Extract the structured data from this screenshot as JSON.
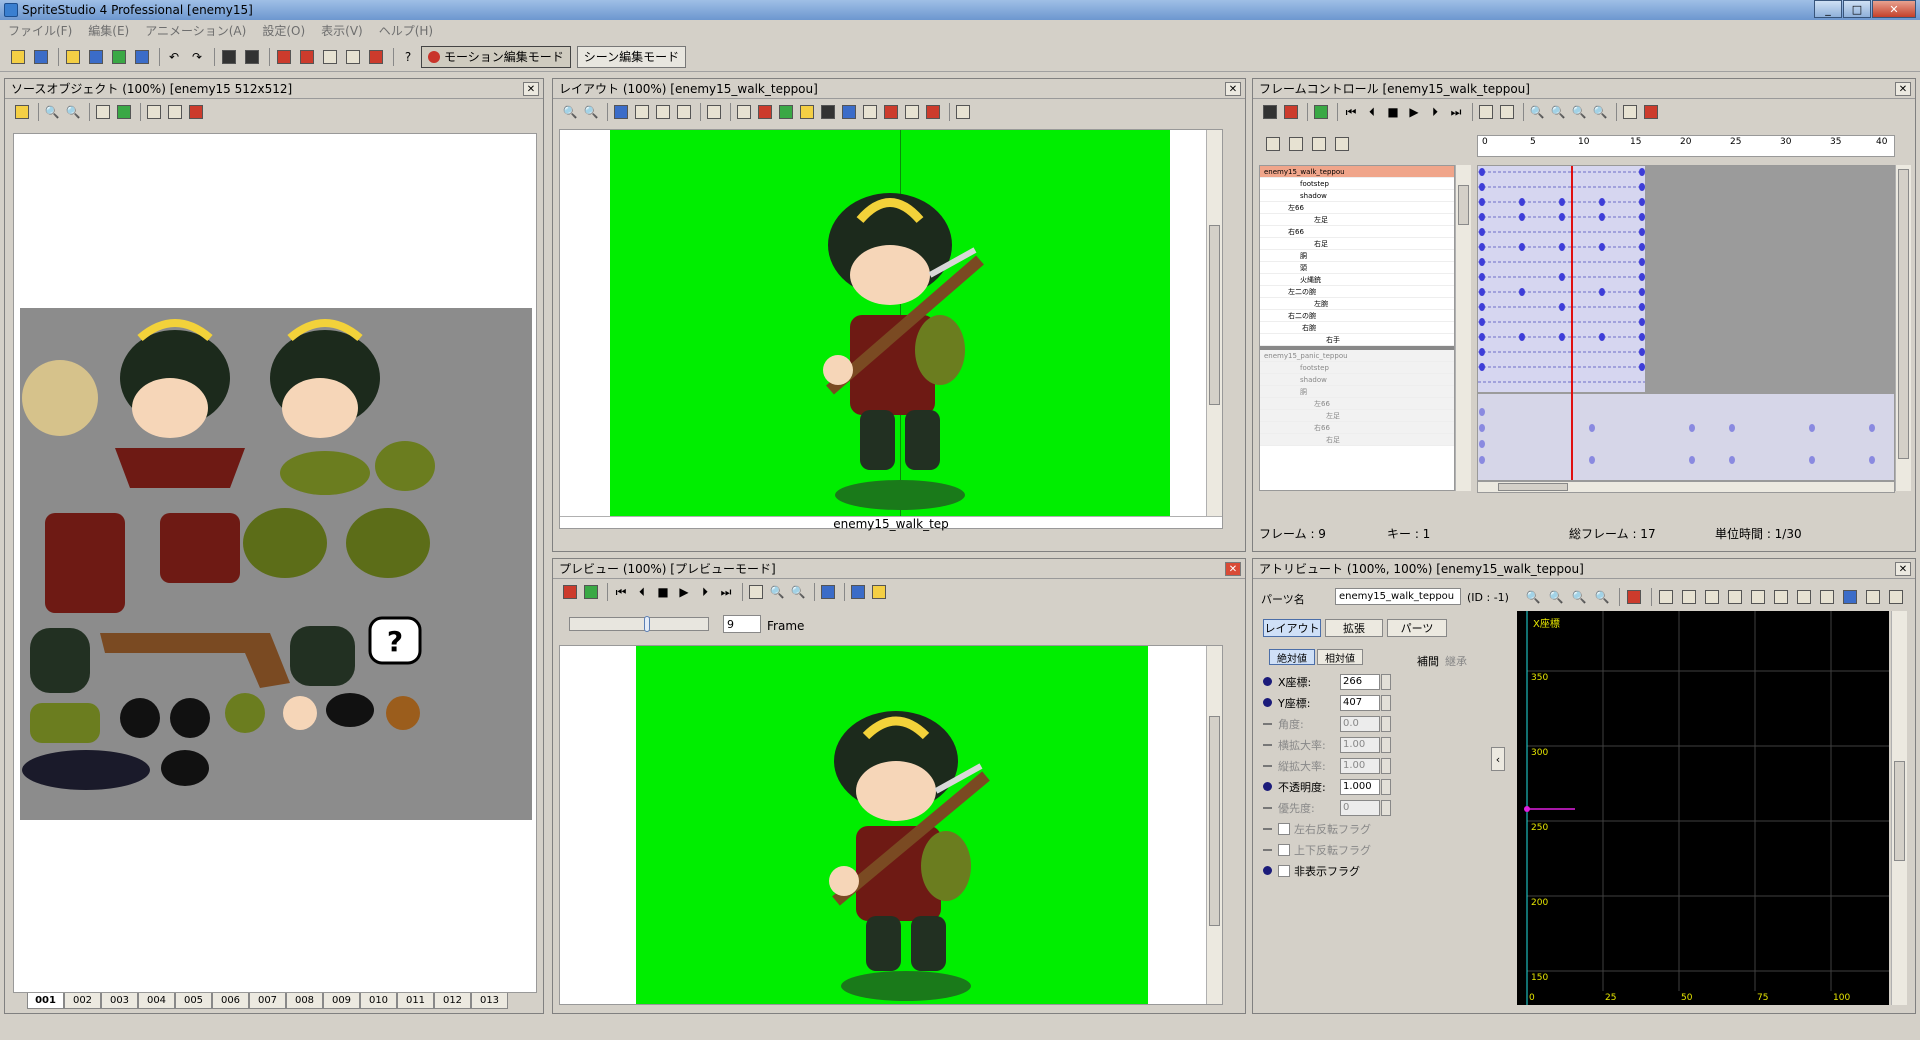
{
  "app": {
    "title": "SpriteStudio 4 Professional [enemy15]"
  },
  "menu": [
    "ファイル(F)",
    "編集(E)",
    "アニメーション(A)",
    "設定(O)",
    "表示(V)",
    "ヘルプ(H)"
  ],
  "toolbar": {
    "motion_mode": "モーション編集モード",
    "scene_mode": "シーン編集モード"
  },
  "source": {
    "title": "ソースオブジェクト (100%) [enemy15  512x512]",
    "tabs": [
      "001",
      "002",
      "003",
      "004",
      "005",
      "006",
      "007",
      "008",
      "009",
      "010",
      "011",
      "012",
      "013"
    ]
  },
  "layout": {
    "title": "レイアウト (100%) [enemy15_walk_teppou]",
    "status": "enemy15_walk_tep"
  },
  "preview": {
    "title": "プレビュー (100%) [プレビューモード]",
    "frame_value": "9",
    "frame_label": "Frame"
  },
  "frame": {
    "title": "フレームコントロール [enemy15_walk_teppou]",
    "ruler": [
      "0",
      "5",
      "10",
      "15",
      "20",
      "25",
      "30",
      "35",
      "40"
    ],
    "tree1": [
      "enemy15_walk_teppou",
      "footstep",
      "shadow",
      "左66",
      "左足",
      "右66",
      "右足",
      "胴",
      "頭",
      "火縄銃",
      "左二の腕",
      "左腕",
      "右二の腕",
      "右腕",
      "右手"
    ],
    "tree2": [
      "enemy15_panic_teppou",
      "footstep",
      "shadow",
      "胴",
      "左66",
      "左足",
      "右66",
      "右足"
    ],
    "status": {
      "frame": "フレーム : 9",
      "key": "キー : 1",
      "total": "総フレーム : 17",
      "unit": "単位時間 : 1/30"
    }
  },
  "attr": {
    "title": "アトリビュート (100%, 100%) [enemy15_walk_teppou]",
    "part_label": "パーツ名",
    "part_name": "enemy15_walk_teppou",
    "part_id": "(ID : -1)",
    "tabs": [
      "レイアウト",
      "拡張",
      "パーツ"
    ],
    "mode_abs": "絶対値",
    "mode_rel": "相対値",
    "interp": "補間",
    "inherit": "継承",
    "rows": [
      {
        "label": "X座標:",
        "value": "266"
      },
      {
        "label": "Y座標:",
        "value": "407"
      },
      {
        "label": "角度:",
        "value": "0.0"
      },
      {
        "label": "横拡大率:",
        "value": "1.00"
      },
      {
        "label": "縦拡大率:",
        "value": "1.00"
      },
      {
        "label": "不透明度:",
        "value": "1.000"
      },
      {
        "label": "優先度:",
        "value": "0"
      }
    ],
    "flags": [
      "左右反転フラグ",
      "上下反転フラグ",
      "非表示フラグ"
    ],
    "graph": {
      "title": "X座標",
      "ylabels": [
        "350",
        "300",
        "250",
        "200",
        "150"
      ],
      "xlabels": [
        "0",
        "25",
        "50",
        "75",
        "100"
      ]
    }
  },
  "colors": {
    "chroma": "#00ee00",
    "accent": "#f0a58a",
    "graphbg": "#000000"
  }
}
